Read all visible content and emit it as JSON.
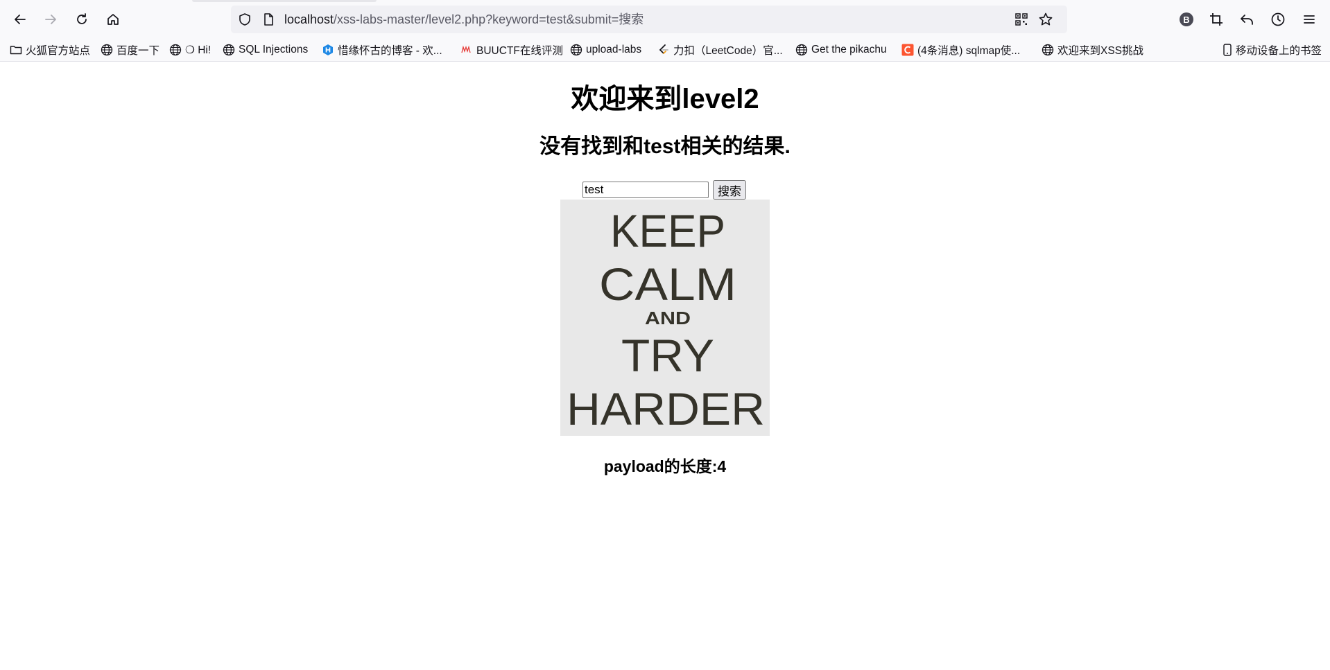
{
  "browser": {
    "url_host": "localhost",
    "url_path": "/xss-labs-master/level2.php?keyword=test&submit=搜索",
    "profile_initial": "B"
  },
  "bookmarks": {
    "items": [
      {
        "label": "火狐官方站点",
        "icon": "folder-icon"
      },
      {
        "label": "百度一下",
        "icon": "globe-icon"
      },
      {
        "label": "❍ Hi!",
        "icon": "globe-icon"
      },
      {
        "label": "SQL Injections",
        "icon": "globe-icon"
      },
      {
        "label": "惜缘怀古的博客 - 欢...",
        "icon": "hexagon-h-icon"
      },
      {
        "label": "BUUCTF在线评测",
        "icon": "buuctf-icon"
      },
      {
        "label": "upload-labs",
        "icon": "globe-icon"
      },
      {
        "label": "力扣（LeetCode）官...",
        "icon": "leetcode-icon"
      },
      {
        "label": "Get the pikachu",
        "icon": "globe-icon"
      },
      {
        "label": "(4条消息) sqlmap使...",
        "icon": "csdn-icon"
      },
      {
        "label": "欢迎来到XSS挑战",
        "icon": "globe-icon"
      }
    ],
    "mobile_label": "移动设备上的书签"
  },
  "page": {
    "heading": "欢迎来到level2",
    "result_text": "没有找到和test相关的结果.",
    "search_value": "test",
    "search_button": "搜索",
    "poster_lines": [
      "KEEP",
      "CALM",
      "AND",
      "TRY",
      "HARDER"
    ],
    "payload_length": "payload的长度:4"
  },
  "colors": {
    "poster_bg": "#e8e8e8",
    "poster_text": "#35332a",
    "csdn_red": "#fc5531",
    "hexo_blue": "#1e88e5"
  }
}
